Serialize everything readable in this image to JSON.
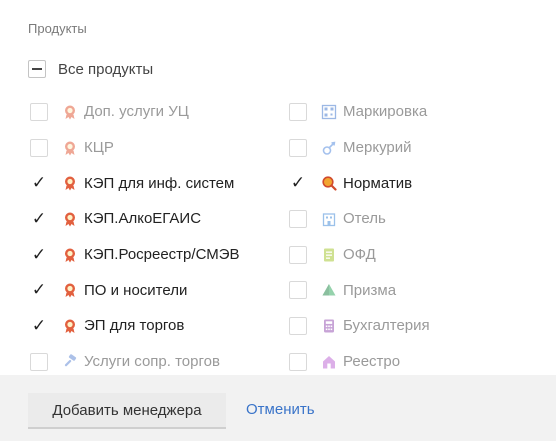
{
  "section_title": "Продукты",
  "all_products": {
    "label": "Все продукты",
    "state": "indeterminate"
  },
  "left_column": [
    {
      "label": "Доп. услуги УЦ",
      "checked": false,
      "icon": "award-icon"
    },
    {
      "label": "КЦР",
      "checked": false,
      "icon": "award-icon"
    },
    {
      "label": "КЭП для инф. систем",
      "checked": true,
      "icon": "award-icon"
    },
    {
      "label": "КЭП.АлкоЕГАИС",
      "checked": true,
      "icon": "award-icon"
    },
    {
      "label": "КЭП.Росреестр/СМЭВ",
      "checked": true,
      "icon": "award-icon"
    },
    {
      "label": "ПО и носители",
      "checked": true,
      "icon": "award-icon"
    },
    {
      "label": "ЭП для торгов",
      "checked": true,
      "icon": "award-icon"
    },
    {
      "label": "Услуги сопр. торгов",
      "checked": false,
      "icon": "gavel-icon"
    }
  ],
  "right_column": [
    {
      "label": "Маркировка",
      "checked": false,
      "icon": "qr-code-icon"
    },
    {
      "label": "Меркурий",
      "checked": false,
      "icon": "mercury-icon"
    },
    {
      "label": "Норматив",
      "checked": true,
      "icon": "magnifier-icon"
    },
    {
      "label": "Отель",
      "checked": false,
      "icon": "hotel-icon"
    },
    {
      "label": "ОФД",
      "checked": false,
      "icon": "receipt-icon"
    },
    {
      "label": "Призма",
      "checked": false,
      "icon": "prism-icon"
    },
    {
      "label": "Бухгалтерия",
      "checked": false,
      "icon": "calculator-icon"
    },
    {
      "label": "Реестро",
      "checked": false,
      "icon": "house-icon"
    }
  ],
  "footer": {
    "add_button": "Добавить менеджера",
    "cancel_link": "Отменить"
  },
  "colors": {
    "link": "#3a74c9",
    "check": "#222222",
    "footer_bg": "#f2f2f2"
  }
}
